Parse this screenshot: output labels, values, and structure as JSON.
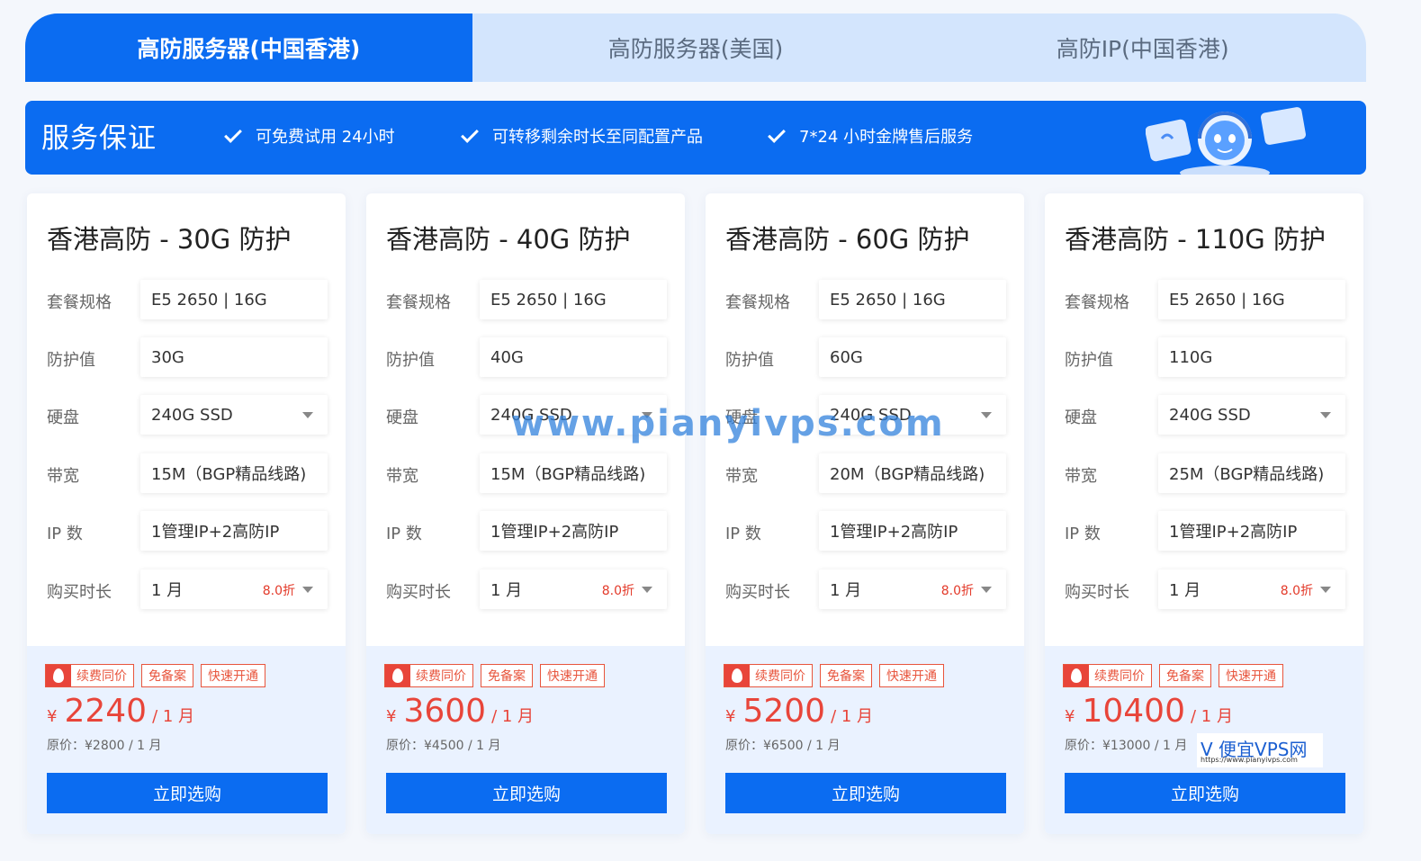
{
  "tabs": [
    {
      "label": "高防服务器(中国香港)",
      "active": true
    },
    {
      "label": "高防服务器(美国)",
      "active": false
    },
    {
      "label": "高防IP(中国香港)",
      "active": false
    }
  ],
  "banner": {
    "title": "服务保证",
    "features": [
      "可免费试用 24小时",
      "可转移剩余时长至同配置产品",
      "7*24 小时金牌售后服务"
    ]
  },
  "labels": {
    "spec": "套餐规格",
    "protection": "防护值",
    "disk": "硬盘",
    "bandwidth": "带宽",
    "ip": "IP 数",
    "duration": "购买时长",
    "badge_renew": "续费同价",
    "badge_norecord": "免备案",
    "badge_fast": "快速开通",
    "currency": "¥",
    "buy": "立即选购"
  },
  "cards": [
    {
      "title": "香港高防 - 30G 防护",
      "spec": "E5 2650 | 16G",
      "protection": "30G",
      "disk": "240G SSD",
      "bandwidth": "15M（BGP精品线路)",
      "ip": "1管理IP+2高防IP",
      "duration": "1 月",
      "discount": "8.0折",
      "price": "2240",
      "unit": "/ 1 月",
      "original": "原价：¥2800 / 1 月"
    },
    {
      "title": "香港高防 - 40G 防护",
      "spec": "E5 2650 | 16G",
      "protection": "40G",
      "disk": "240G SSD",
      "bandwidth": "15M（BGP精品线路)",
      "ip": "1管理IP+2高防IP",
      "duration": "1 月",
      "discount": "8.0折",
      "price": "3600",
      "unit": "/ 1 月",
      "original": "原价：¥4500 / 1 月"
    },
    {
      "title": "香港高防 - 60G 防护",
      "spec": "E5 2650 | 16G",
      "protection": "60G",
      "disk": "240G SSD",
      "bandwidth": "20M（BGP精品线路)",
      "ip": "1管理IP+2高防IP",
      "duration": "1 月",
      "discount": "8.0折",
      "price": "5200",
      "unit": "/ 1 月",
      "original": "原价：¥6500 / 1 月"
    },
    {
      "title": "香港高防 - 110G 防护",
      "spec": "E5 2650 | 16G",
      "protection": "110G",
      "disk": "240G SSD",
      "bandwidth": "25M（BGP精品线路)",
      "ip": "1管理IP+2高防IP",
      "duration": "1 月",
      "discount": "8.0折",
      "price": "10400",
      "unit": "/ 1 月",
      "original": "原价：¥13000 / 1 月"
    }
  ],
  "watermark": "www.pianyivps.com",
  "logo": {
    "main": "V 便宜VPS网",
    "sub": "https://www.pianyivps.com"
  },
  "colors": {
    "primary": "#0b6cf1",
    "price": "#e8453a",
    "tab_inactive": "#d3e5fd"
  }
}
